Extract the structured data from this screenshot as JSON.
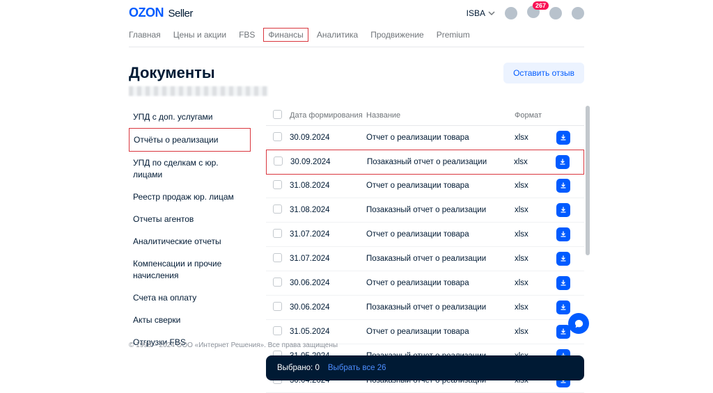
{
  "logo": {
    "brand": "OZON",
    "suffix": "Seller"
  },
  "account": {
    "name": "ISBA",
    "notif_count": "267"
  },
  "nav": [
    {
      "label": "Главная",
      "hl": false
    },
    {
      "label": "Цены и акции",
      "hl": false
    },
    {
      "label": "FBS",
      "hl": false
    },
    {
      "label": "Финансы",
      "hl": true
    },
    {
      "label": "Аналитика",
      "hl": false
    },
    {
      "label": "Продвижение",
      "hl": false
    },
    {
      "label": "Premium",
      "hl": false
    }
  ],
  "page": {
    "title": "Документы",
    "feedback_btn": "Оставить отзыв"
  },
  "sidebar": [
    {
      "label": "УПД с доп. услугами",
      "hl": false
    },
    {
      "label": "Отчёты о реализации",
      "hl": true
    },
    {
      "label": "УПД по сделкам с юр. лицами",
      "hl": false
    },
    {
      "label": "Реестр продаж юр. лицам",
      "hl": false
    },
    {
      "label": "Отчеты агентов",
      "hl": false
    },
    {
      "label": "Аналитические отчеты",
      "hl": false
    },
    {
      "label": "Компенсации и прочие начисления",
      "hl": false
    },
    {
      "label": "Счета на оплату",
      "hl": false
    },
    {
      "label": "Акты сверки",
      "hl": false
    },
    {
      "label": "Отгрузки FBS",
      "hl": false
    }
  ],
  "table": {
    "headers": {
      "date": "Дата формирования",
      "name": "Название",
      "format": "Формат"
    },
    "rows": [
      {
        "date": "30.09.2024",
        "name": "Отчет о реализации товара",
        "format": "xlsx",
        "hl": false
      },
      {
        "date": "30.09.2024",
        "name": "Позаказный отчет о реализации",
        "format": "xlsx",
        "hl": true
      },
      {
        "date": "31.08.2024",
        "name": "Отчет о реализации товара",
        "format": "xlsx",
        "hl": false
      },
      {
        "date": "31.08.2024",
        "name": "Позаказный отчет о реализации",
        "format": "xlsx",
        "hl": false
      },
      {
        "date": "31.07.2024",
        "name": "Отчет о реализации товара",
        "format": "xlsx",
        "hl": false
      },
      {
        "date": "31.07.2024",
        "name": "Позаказный отчет о реализации",
        "format": "xlsx",
        "hl": false
      },
      {
        "date": "30.06.2024",
        "name": "Отчет о реализации товара",
        "format": "xlsx",
        "hl": false
      },
      {
        "date": "30.06.2024",
        "name": "Позаказный отчет о реализации",
        "format": "xlsx",
        "hl": false
      },
      {
        "date": "31.05.2024",
        "name": "Отчет о реализации товара",
        "format": "xlsx",
        "hl": false
      },
      {
        "date": "31.05.2024",
        "name": "Позаказный отчет о реализации",
        "format": "xlsx",
        "hl": false
      },
      {
        "date": "30.04.2024",
        "name": "Позаказный отчет о реализации",
        "format": "xlsx",
        "hl": false
      }
    ]
  },
  "selection_bar": {
    "label": "Выбрано: 0",
    "link": "Выбрать все 26"
  },
  "footer": "© 1998 – 2024 ООО «Интернет Решения». Все права защищены"
}
